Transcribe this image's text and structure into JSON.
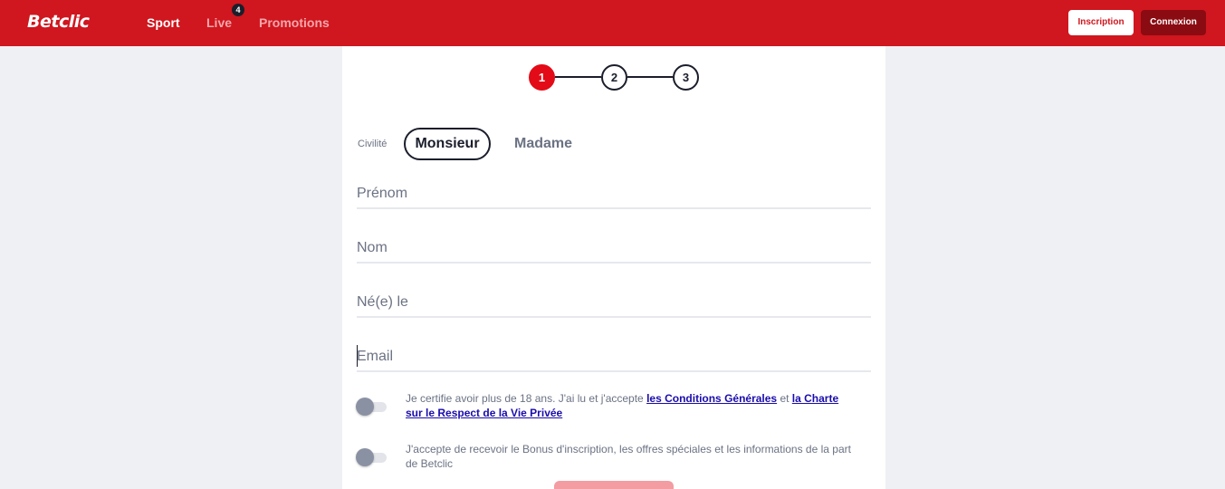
{
  "header": {
    "logo": "Betclic",
    "nav": [
      {
        "label": "Sport",
        "active": true
      },
      {
        "label": "Live",
        "badge": "4"
      },
      {
        "label": "Promotions"
      }
    ],
    "inscription_label": "Inscription",
    "connexion_label": "Connexion"
  },
  "steps": {
    "items": [
      "1",
      "2",
      "3"
    ],
    "current": 1
  },
  "form": {
    "civility": {
      "label": "Civilité",
      "options": [
        "Monsieur",
        "Madame"
      ],
      "selected": "Monsieur"
    },
    "fields": {
      "prenom": {
        "placeholder": "Prénom",
        "value": ""
      },
      "nom": {
        "placeholder": "Nom",
        "value": ""
      },
      "naissance": {
        "placeholder": "Né(e) le",
        "value": ""
      },
      "email": {
        "placeholder": "Email",
        "value": ""
      }
    },
    "consent_terms": {
      "text_before": "Je certifie avoir plus de 18 ans. J'ai lu et j'accepte ",
      "link1": "les Conditions Générales",
      "text_mid": " et ",
      "link2": "la Charte sur le Respect de la Vie Privée",
      "checked": false
    },
    "consent_bonus": {
      "text": "J'accepte de recevoir le Bonus d'inscription, les offres spéciales et les informations de la part de Betclic",
      "checked": false
    }
  },
  "colors": {
    "brand_red": "#d0161e",
    "step_active": "#e30b17",
    "dark_red": "#8b0b12",
    "text_dark": "#1b1e2b",
    "text_muted": "#6b7283",
    "page_bg": "#eef0f4",
    "submit_disabled": "#f39ca1"
  }
}
